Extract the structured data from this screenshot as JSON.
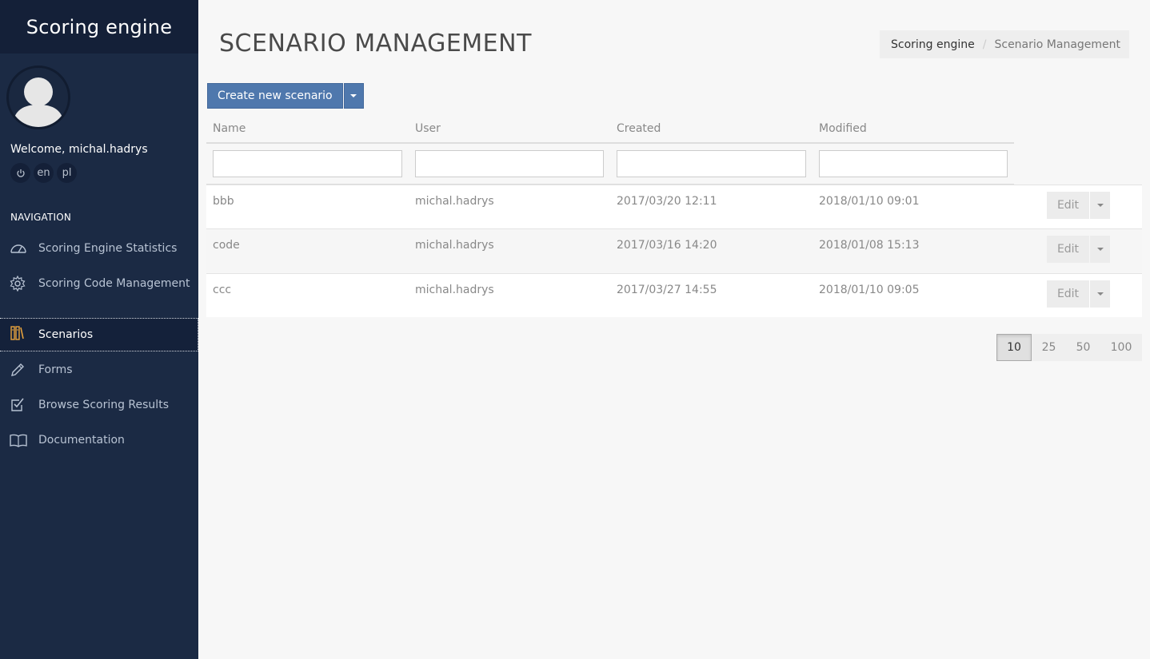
{
  "app": {
    "title": "Scoring engine"
  },
  "user": {
    "welcome": "Welcome, michal.hadrys",
    "quick_actions": [
      {
        "icon": "power-icon",
        "label": "⏻"
      },
      {
        "icon": "language-en",
        "label": "en"
      },
      {
        "icon": "language-pl",
        "label": "pl"
      }
    ]
  },
  "sidebar": {
    "heading": "NAVIGATION",
    "items": [
      {
        "label": "Scoring Engine Statistics",
        "icon": "dashboard-gauge-icon",
        "active": false
      },
      {
        "label": "Scoring Code Management",
        "icon": "gear-icon",
        "active": false
      },
      {
        "label": "Scenarios",
        "icon": "book-shelf-icon",
        "active": true
      },
      {
        "label": "Forms",
        "icon": "pencil-icon",
        "active": false
      },
      {
        "label": "Browse Scoring Results",
        "icon": "checkbox-icon",
        "active": false
      },
      {
        "label": "Documentation",
        "icon": "open-book-icon",
        "active": false
      }
    ]
  },
  "page": {
    "title": "SCENARIO MANAGEMENT",
    "breadcrumb": {
      "home": "Scoring engine",
      "separator": "/",
      "current": "Scenario Management"
    },
    "create_button": "Create new scenario"
  },
  "table": {
    "columns": [
      "Name",
      "User",
      "Created",
      "Modified"
    ],
    "filters": [
      "",
      "",
      "",
      ""
    ],
    "rows": [
      {
        "name": "bbb",
        "user": "michal.hadrys",
        "created": "2017/03/20 12:11",
        "modified": "2018/01/10 09:01",
        "action": "Edit"
      },
      {
        "name": "code",
        "user": "michal.hadrys",
        "created": "2017/03/16 14:20",
        "modified": "2018/01/08 15:13",
        "action": "Edit"
      },
      {
        "name": "ccc",
        "user": "michal.hadrys",
        "created": "2017/03/27 14:55",
        "modified": "2018/01/10 09:05",
        "action": "Edit"
      }
    ]
  },
  "pagination": {
    "page_sizes": [
      "10",
      "25",
      "50",
      "100"
    ],
    "selected": "10"
  },
  "colors": {
    "sidebar_bg": "#1b2a44",
    "brand_bg": "#142038",
    "primary": "#4f78ad",
    "active_icon": "#e8a33d"
  }
}
